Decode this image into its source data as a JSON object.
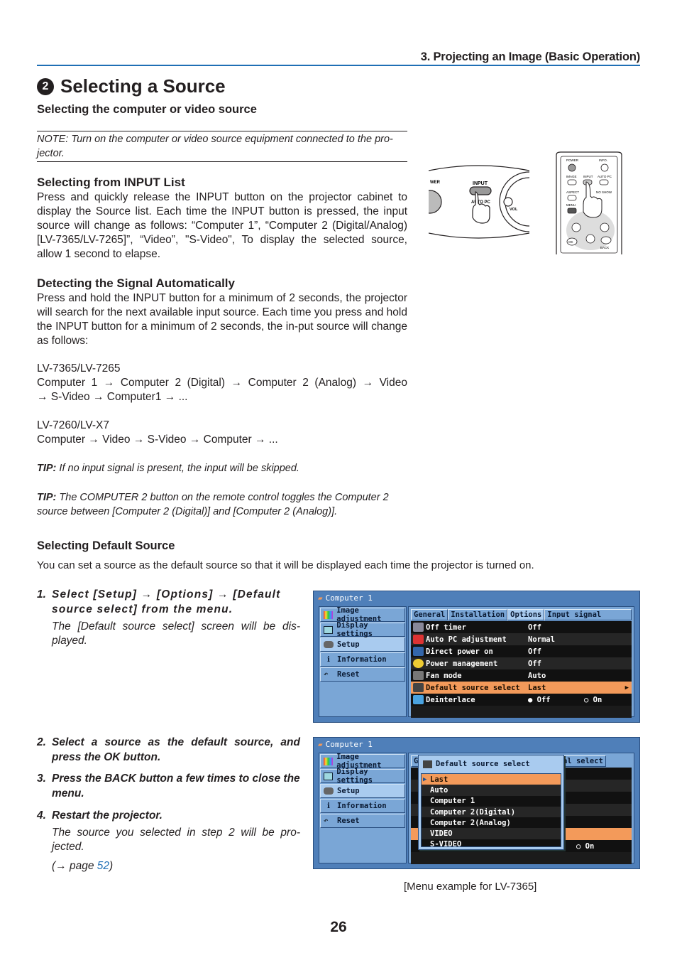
{
  "header": {
    "chapter": "3. Projecting an Image (Basic Operation)",
    "section_number": "2",
    "title": "Selecting a Source",
    "subtitle": "Selecting the computer or video source"
  },
  "note": "NOTE: Turn on the computer or video source equipment connected to the pro-jector.",
  "input_list": {
    "heading": "Selecting from INPUT List",
    "body": "Press and quickly release the INPUT button on the projector cabinet to display the Source list. Each time the INPUT button is pressed, the input source will change as follows: “Computer 1”, “Computer 2 (Digital/Analog) [LV-7365/LV-7265]”, “Video”, \"S-Video\", To display the selected source, allow 1 second to elapse."
  },
  "auto_detect": {
    "heading": "Detecting the Signal Automatically",
    "body": "Press and hold the INPUT button for a minimum of 2 seconds, the projector will search for the next available input source. Each time you press and hold the INPUT button for a minimum of 2 seconds, the in-put source will change as follows:",
    "models_a": "LV-7365/LV-7265",
    "sequence_a_line1": "Computer 1 → Computer 2 (Digital) → Computer 2 (Analog) → Video",
    "sequence_a_line2": "→ S-Video → Computer1 → ...",
    "models_b": "LV-7260/LV-X7",
    "sequence_b": "Computer → Video → S-Video → Computer → ..."
  },
  "tips": [
    {
      "label": "TIP:",
      "text": " If no input signal is present, the input will be skipped."
    },
    {
      "label": "TIP:",
      "text": " The COMPUTER 2 button on the remote control toggles the Computer 2 source between [Computer 2 (Digital)] and [Computer 2 (Analog)]."
    }
  ],
  "illustration": {
    "cabinet_labels": {
      "input": "INPUT",
      "auto_pc": "AUTO PC",
      "vol": "VOL",
      "power": "WER"
    },
    "remote_labels": [
      "POWER",
      "INFO.",
      "IMAGE",
      "INPUT",
      "AUTO PC",
      "ASPECT",
      "NO SHOW",
      "MENU",
      "OK",
      "BACK"
    ]
  },
  "default_source": {
    "heading": "Selecting Default Source",
    "intro": "You can set a source as the default source so that it will be displayed each time the projector is turned on.",
    "steps": [
      {
        "num": "1.",
        "text": "Select [Setup] → [Options] → [Default source select] from the menu.",
        "sub": "The [Default source select] screen will be dis-played."
      },
      {
        "num": "2.",
        "text": "Select a source as the default source, and press the OK button."
      },
      {
        "num": "3.",
        "text": "Press the BACK button a few times to close the menu."
      },
      {
        "num": "4.",
        "text": "Restart the projector.",
        "sub": "The source you selected in step 2 will be pro-jected."
      }
    ],
    "page_ref_prefix": "(→ page ",
    "page_ref_link": "52",
    "page_ref_suffix": ")"
  },
  "osd": {
    "window_title": "Computer 1",
    "left_menu": [
      "Image adjustment",
      "Display settings",
      "Setup",
      "Information",
      "Reset"
    ],
    "active_left": "Setup",
    "tabs": [
      "General",
      "Installation",
      "Options",
      "Input signal select"
    ],
    "active_tab": "Options",
    "rows": [
      {
        "label": "Off timer",
        "value": "Off"
      },
      {
        "label": "Auto PC adjustment",
        "value": "Normal"
      },
      {
        "label": "Direct power on",
        "value": "Off"
      },
      {
        "label": "Power management",
        "value": "Off"
      },
      {
        "label": "Fan mode",
        "value": "Auto"
      },
      {
        "label": "Default source select",
        "value": "Last",
        "selected": true
      },
      {
        "label": "Deinterlace",
        "value": "● Off",
        "value2": "○ On"
      }
    ],
    "popup_title": "Default source select",
    "popup_options": [
      "Last",
      "Auto",
      "Computer 1",
      "Computer 2(Digital)",
      "Computer 2(Analog)",
      "VIDEO",
      "S-VIDEO"
    ],
    "popup_selected": "Last",
    "tab_partial": "al select",
    "tab_partial_first": "G",
    "deinterlace_on": "○ On",
    "colors": {
      "highlight": "#f39a5a",
      "frame": "#4f7fb9",
      "panel": "#7aa6d6"
    }
  },
  "caption": "[Menu example for LV-7365]",
  "page_number": "26"
}
